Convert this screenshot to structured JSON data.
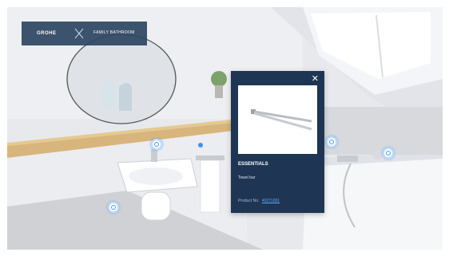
{
  "brand": {
    "logo": "GROHE",
    "title": "FAMILY BATHROOM",
    "accent_color": "#2d4662"
  },
  "popup": {
    "close_icon": "✕",
    "series": "ESSENTIALS",
    "product_name": "Towel bar",
    "product_no_label": "Product No.",
    "product_no": "40371001"
  },
  "hotspots": [
    {
      "name": "hotspot-sink-tap"
    },
    {
      "name": "hotspot-towel-bar"
    },
    {
      "name": "hotspot-basin"
    },
    {
      "name": "hotspot-shower-valve"
    },
    {
      "name": "hotspot-shower-head"
    }
  ]
}
